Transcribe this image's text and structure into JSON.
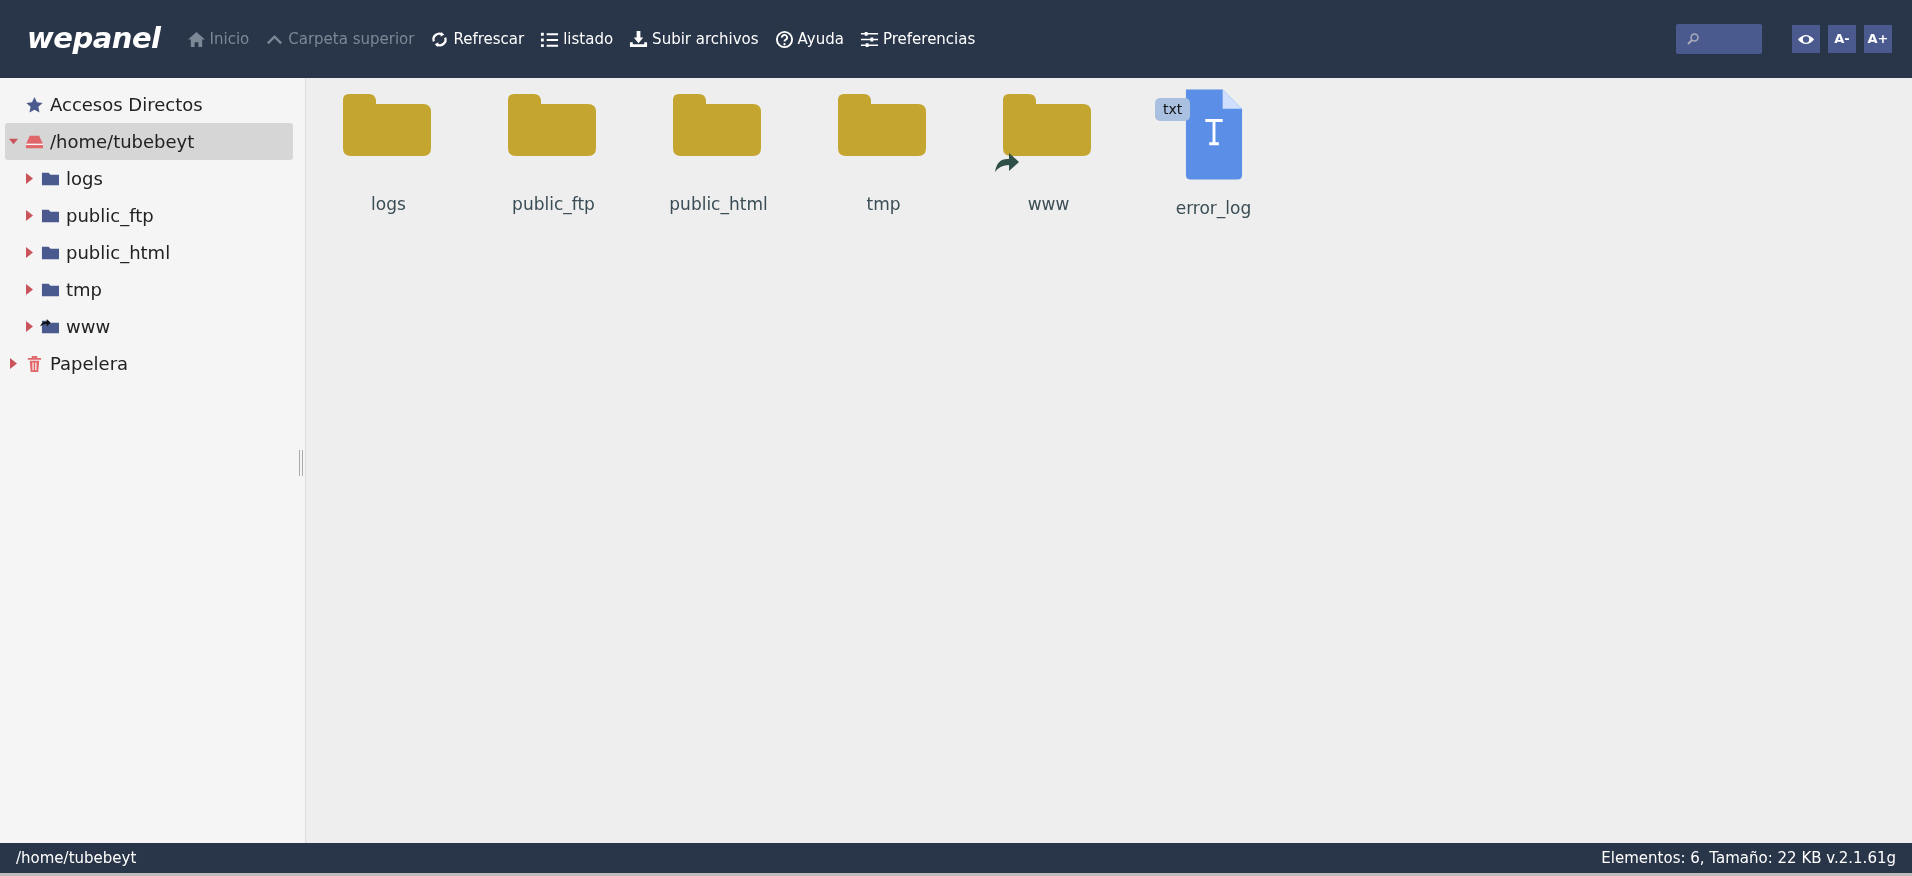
{
  "logo": "wepanel",
  "toolbar": [
    {
      "kind": "home",
      "label": "Inicio",
      "disabled": true
    },
    {
      "kind": "up",
      "label": "Carpeta superior",
      "disabled": true
    },
    {
      "kind": "refresh",
      "label": "Refrescar",
      "disabled": false
    },
    {
      "kind": "list",
      "label": "listado",
      "disabled": false
    },
    {
      "kind": "upload",
      "label": "Subir archivos",
      "disabled": false
    },
    {
      "kind": "help",
      "label": "Ayuda",
      "disabled": false
    },
    {
      "kind": "sliders",
      "label": "Preferencias",
      "disabled": false
    }
  ],
  "view_buttons": [
    {
      "kind": "eye"
    },
    {
      "kind": "text",
      "label": "A-"
    },
    {
      "kind": "text",
      "label": "A+"
    }
  ],
  "sidebar": {
    "items": [
      {
        "kind": "star",
        "label": "Accesos Directos",
        "selected": false
      },
      {
        "kind": "drive",
        "label": "/home/tubebeyt",
        "selected": true,
        "expanded": true,
        "children": [
          {
            "kind": "folder",
            "label": "logs",
            "selected": false,
            "expanded": false,
            "link": false
          },
          {
            "kind": "folder",
            "label": "public_ftp",
            "selected": false,
            "expanded": false,
            "link": false
          },
          {
            "kind": "folder",
            "label": "public_html",
            "selected": false,
            "expanded": false,
            "link": false
          },
          {
            "kind": "folder",
            "label": "tmp",
            "selected": false,
            "expanded": false,
            "link": false
          },
          {
            "kind": "folder",
            "label": "www",
            "selected": false,
            "expanded": false,
            "link": true
          }
        ]
      },
      {
        "kind": "trash",
        "label": "Papelera",
        "selected": false,
        "expanded": false
      }
    ]
  },
  "files": [
    {
      "kind": "folder",
      "name": "logs",
      "link": false
    },
    {
      "kind": "folder",
      "name": "public_ftp",
      "link": false
    },
    {
      "kind": "folder",
      "name": "public_html",
      "link": false
    },
    {
      "kind": "folder",
      "name": "tmp",
      "link": false
    },
    {
      "kind": "folder",
      "name": "www",
      "link": true
    },
    {
      "kind": "text-file",
      "name": "error_log",
      "badge": "txt"
    }
  ],
  "status_bar": {
    "path": "/home/tubebeyt",
    "info": "Elementos: 6, Tamaño: 22 KB v.2.1.61g"
  }
}
